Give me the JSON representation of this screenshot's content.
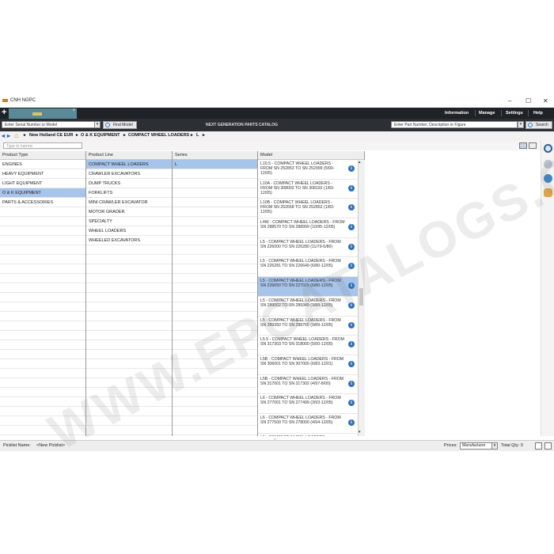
{
  "window": {
    "title": "CNH NGPC",
    "controls": [
      "–",
      "☐",
      "✕"
    ]
  },
  "appbar": {
    "tab_close": "×",
    "menu": [
      "Information",
      "Manage",
      "Settings",
      "Help"
    ]
  },
  "search": {
    "serial_placeholder": "Enter Serial Number or Model",
    "find_model_label": "Find Model",
    "catalog_title": "NEXT GENERATION PARTS CATALOG",
    "part_placeholder": "Enter Part Number, Description or Figure",
    "search_label": "Search"
  },
  "breadcrumb": {
    "items": [
      "New Holland CE EUR",
      "O & K EQUIPMENT",
      "COMPACT WHEEL LOADERS",
      "L"
    ]
  },
  "filter": {
    "placeholder": "Type to narrow"
  },
  "columns": {
    "product_type": {
      "header": "Product Type",
      "items": [
        "ENGINES",
        "HEAVY EQUIPMENT",
        "LIGHT EQUIPMENT",
        "O & K EQUIPMENT",
        "PARTS & ACCESSORIES"
      ],
      "selected": 3
    },
    "product_line": {
      "header": "Product Line",
      "items": [
        "COMPACT WHEEL LOADERS",
        "CRAWLER EXCAVATORS",
        "DUMP TRUCKS",
        "FORKLIFTS",
        "MINI CRAWLER EXCAVATOR",
        "MOTOR GRADER",
        "SPECIALTY",
        "WHEEL LOADERS",
        "WHEELED EXCAVATORS"
      ],
      "selected": 0
    },
    "series": {
      "header": "Series",
      "items": [
        "L"
      ],
      "selected": 0
    },
    "model": {
      "header": "Model",
      "items": [
        "L10.5 - COMPACT WHEEL LOADERS - FROM SN 252853 TO SN 252999 (5/00-12/05)",
        "L10A - COMPACT WHEEL LOADERS - FROM SN 308002 TO SN 308192 (1/83-12/05)",
        "L10B - COMPACT WHEEL LOADERS - FROM SN 252658 TO SN 252852 (1/83-12/05)",
        "L4W - COMPACT WHEEL LOADERS - FROM SN 288570 TO SN 288999 (10/95-12/05)",
        "L5 - COMPACT WHEEL LOADERS - FROM SN 226000 TO SN 226280 (11/79-5/80)",
        "L5 - COMPACT WHEEL LOADERS - FROM SN 226281 TO SN 226649 (6/80-12/05)",
        "L5 - COMPACT WHEEL LOADERS - FROM SN 226650 TO SN 227029 (6/80-12/05)",
        "L5 - COMPACT WHEEL LOADERS - FROM SN 289002 TO SN 289349 (9/89-12/05)",
        "L5 - COMPACT WHEEL LOADERS - FROM SN 289350 TO SN 288760 (9/89-12/05)",
        "L5.5 - COMPACT WHEEL LOADERS - FROM SN 317303 TO SN 318000 (5/00-12/05)",
        "L5B - COMPACT WHEEL LOADERS - FROM SN 306001 TO SN 307000 (6/83-12/01)",
        "L5B - COMPACT WHEEL LOADERS - FROM SN 317001 TO SN 317302 (4/97-8/00)",
        "L6 - COMPACT WHEEL LOADERS - FROM SN 277001 TO SN 277499 (3/93-12/05)",
        "L6 - COMPACT WHEEL LOADERS - FROM SN 277500 TO SN 278000 (4/94-12/05)",
        "L6 - COMPACT WHEEL LOADERS -"
      ],
      "selected": 6,
      "info_glyph": "i"
    }
  },
  "status": {
    "picklist_label": "Picklist Name:",
    "picklist_value": "<New Picklist>",
    "prices_label": "Prices:",
    "prices_value": "Manufacturer",
    "total_qty": "Total Qty: 0"
  },
  "watermark": "WWW.EPCATALOGS.COM",
  "colors": {
    "selection": "#a7c4ea",
    "appbar": "#1f2328",
    "tab": "#5a8a98",
    "info_icon": "#2f6fb8"
  }
}
